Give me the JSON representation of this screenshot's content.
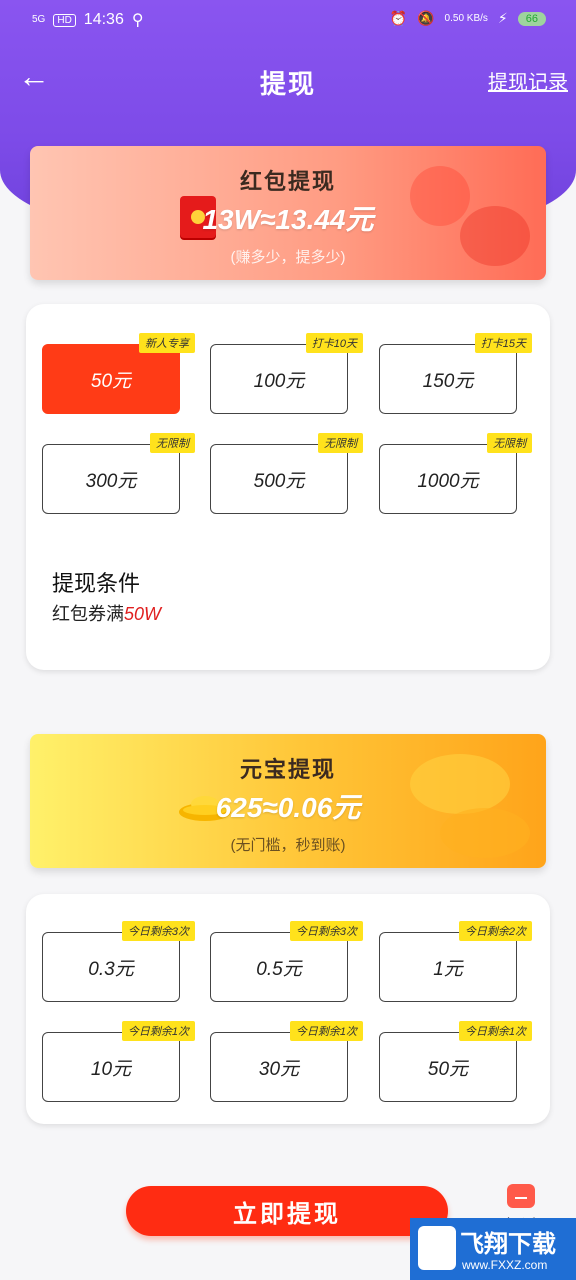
{
  "status_bar": {
    "network": "5G",
    "hd": "HD",
    "time": "14:36",
    "speed": "0.50 KB/s",
    "battery": "66"
  },
  "header": {
    "back_symbol": "←",
    "title": "提现",
    "record_link": "提现记录"
  },
  "red_packet": {
    "title": "红包提现",
    "rate": "13W≈13.44元",
    "subtitle": "(赚多少，提多少)",
    "options": [
      {
        "amount": "50元",
        "tag": "新人专享",
        "selected": true
      },
      {
        "amount": "100元",
        "tag": "打卡10天",
        "selected": false
      },
      {
        "amount": "150元",
        "tag": "打卡15天",
        "selected": false
      },
      {
        "amount": "300元",
        "tag": "无限制",
        "selected": false
      },
      {
        "amount": "500元",
        "tag": "无限制",
        "selected": false
      },
      {
        "amount": "1000元",
        "tag": "无限制",
        "selected": false
      }
    ],
    "condition_title": "提现条件",
    "condition_text": "红包券满",
    "condition_value": "50W"
  },
  "ingot": {
    "title": "元宝提现",
    "rate": "625≈0.06元",
    "subtitle": "(无门槛，秒到账)",
    "options": [
      {
        "amount": "0.3元",
        "tag": "今日剩余3次"
      },
      {
        "amount": "0.5元",
        "tag": "今日剩余3次"
      },
      {
        "amount": "1元",
        "tag": "今日剩余2次"
      },
      {
        "amount": "10元",
        "tag": "今日剩余1次"
      },
      {
        "amount": "30元",
        "tag": "今日剩余1次"
      },
      {
        "amount": "50元",
        "tag": "今日剩余1次"
      }
    ]
  },
  "actions": {
    "submit": "立即提现",
    "complain": "投诉"
  },
  "watermark": {
    "main": "飞翔下载",
    "sub": "www.FXXZ.com"
  },
  "colors": {
    "accent_red": "#ff3b16",
    "tag_yellow": "#ffe21c",
    "header_purple": "#7d4be8"
  }
}
